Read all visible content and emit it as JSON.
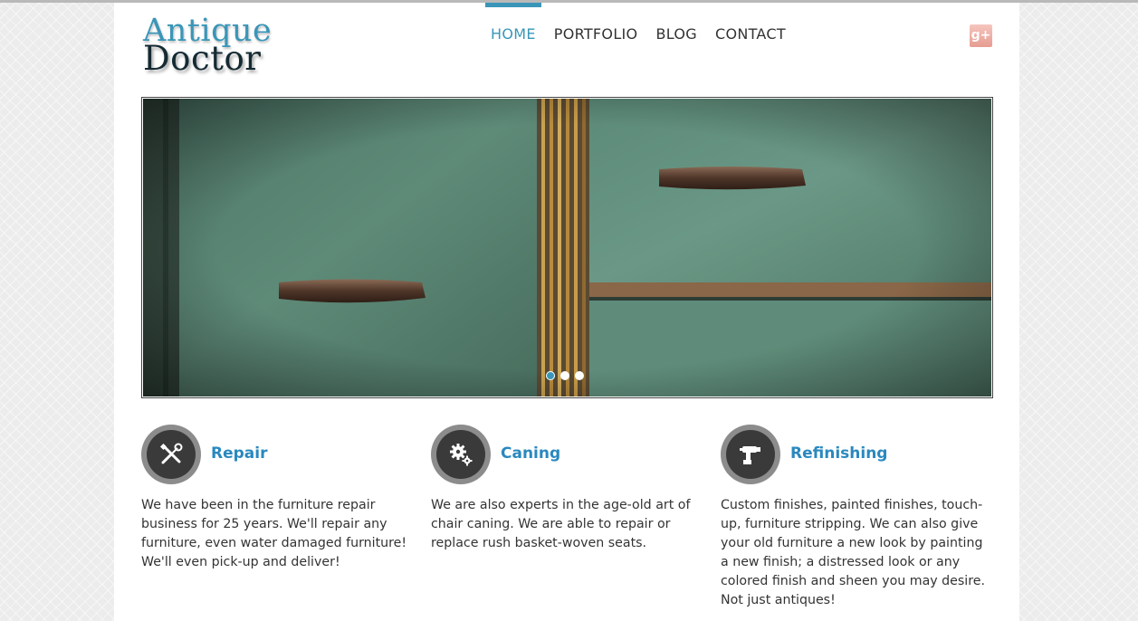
{
  "logo": {
    "line1": "Antique",
    "line2": "Doctor"
  },
  "nav": {
    "items": [
      {
        "label": "HOME",
        "active": true
      },
      {
        "label": "PORTFOLIO",
        "active": false
      },
      {
        "label": "BLOG",
        "active": false
      },
      {
        "label": "CONTACT",
        "active": false
      }
    ]
  },
  "social": {
    "icon": "google-plus-icon",
    "glyph": "g+"
  },
  "slider": {
    "slide_count": 3,
    "active_index": 0,
    "icon": "dresser-drawers-photo"
  },
  "features": [
    {
      "title": "Repair",
      "icon": "wrench-screwdriver-icon",
      "text": "We have been in the furniture repair business for 25 years. We'll repair any furniture, even water damaged furniture! We'll even pick-up and deliver!"
    },
    {
      "title": "Caning",
      "icon": "gears-icon",
      "text": "We are also experts in the age-old art of chair caning. We are able to repair or replace rush basket-woven seats."
    },
    {
      "title": "Refinishing",
      "icon": "spray-gun-icon",
      "text": "Custom finishes, painted finishes, touch-up, furniture stripping. We can also give your old furniture a new look by painting a new finish; a distressed look or any colored finish and sheen you may desire. Not just antiques!"
    }
  ],
  "colors": {
    "accent": "#3a96b8",
    "title_blue": "#2a88bf",
    "text": "#333333"
  }
}
